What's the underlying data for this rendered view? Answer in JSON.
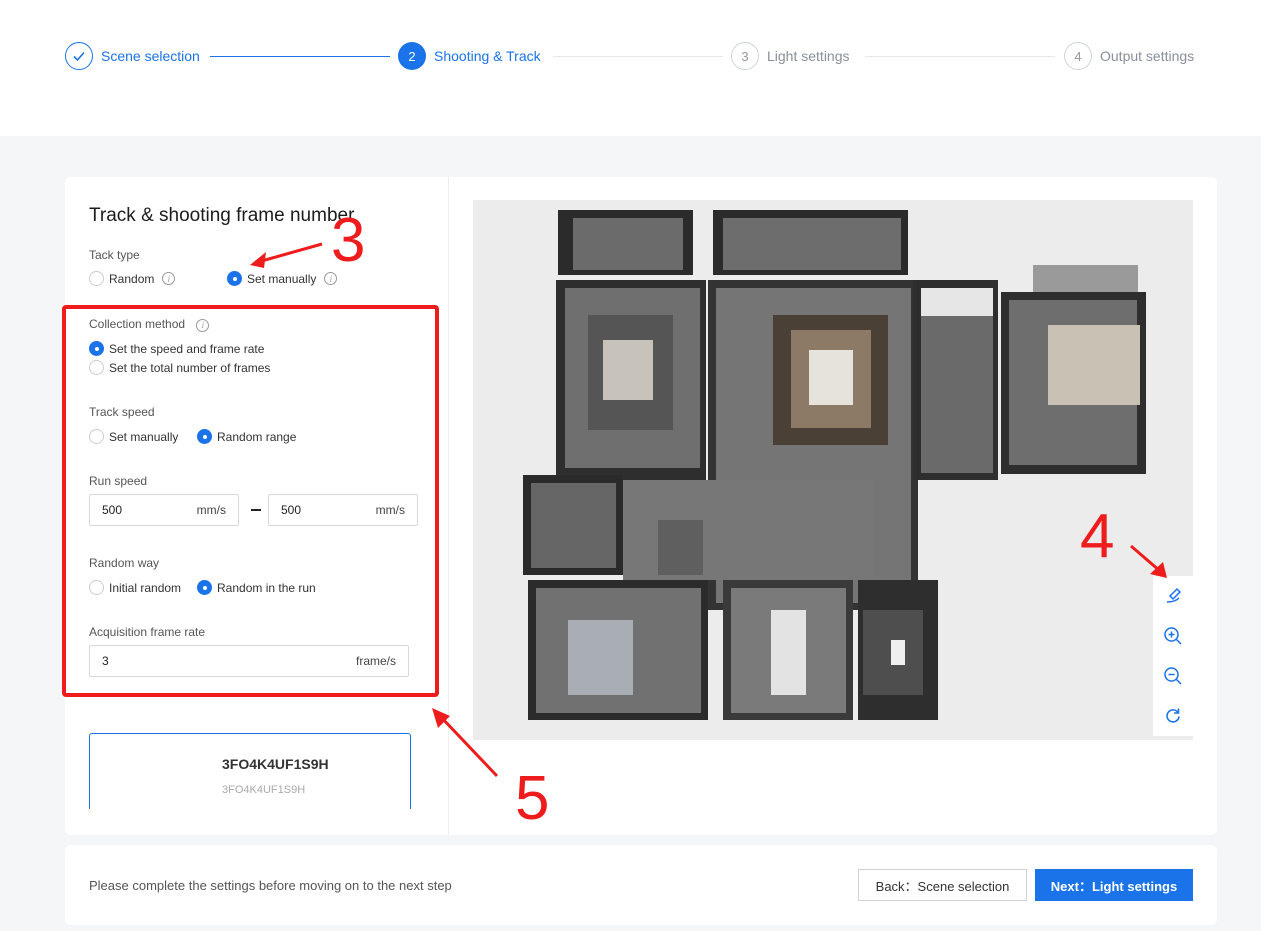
{
  "stepper": {
    "steps": [
      {
        "number": "✓",
        "label": "Scene selection",
        "state": "done"
      },
      {
        "number": "2",
        "label": "Shooting & Track",
        "state": "active"
      },
      {
        "number": "3",
        "label": "Light settings",
        "state": "todo"
      },
      {
        "number": "4",
        "label": "Output settings",
        "state": "todo"
      }
    ]
  },
  "panel": {
    "title": "Track & shooting frame number",
    "tack_type": {
      "label": "Tack type",
      "options": [
        {
          "label": "Random",
          "checked": false,
          "info": true
        },
        {
          "label": "Set manually",
          "checked": true,
          "info": true
        }
      ]
    },
    "collection_method": {
      "label": "Collection method",
      "options": [
        {
          "label": "Set the speed and frame rate",
          "checked": true
        },
        {
          "label": "Set the total number of frames",
          "checked": false
        }
      ]
    },
    "track_speed": {
      "label": "Track speed",
      "options": [
        {
          "label": "Set manually",
          "checked": false
        },
        {
          "label": "Random range",
          "checked": true
        }
      ]
    },
    "run_speed": {
      "label": "Run speed",
      "min_value": "500",
      "max_value": "500",
      "unit": "mm/s"
    },
    "random_way": {
      "label": "Random way",
      "options": [
        {
          "label": "Initial random",
          "checked": false
        },
        {
          "label": "Random in the run",
          "checked": true
        }
      ]
    },
    "acquisition_frame_rate": {
      "label": "Acquisition frame rate",
      "value": "3",
      "unit": "frame/s"
    },
    "scene_card": {
      "title": "3FO4K4UF1S9H",
      "subtitle": "3FO4K4UF1S9H"
    }
  },
  "map_tools": [
    {
      "icon": "draw-track-icon"
    },
    {
      "icon": "zoom-in-icon"
    },
    {
      "icon": "zoom-out-icon"
    },
    {
      "icon": "reset-icon"
    }
  ],
  "annotations": {
    "three": "3",
    "four": "4",
    "five": "5",
    "color": "#ee1c1c"
  },
  "footer": {
    "message": "Please complete the settings before moving on to the next step",
    "back_label": "Back：Scene selection",
    "next_label": "Next：Light settings"
  },
  "colors": {
    "accent": "#1a73e8",
    "annotation": "#ee1c1c"
  }
}
